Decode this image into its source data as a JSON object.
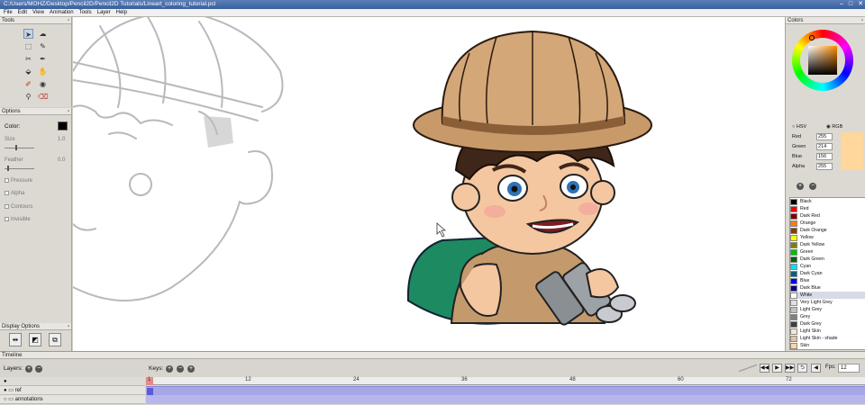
{
  "window": {
    "title": "C:/Users/MOHZ/Desktop/Pencil2D/Pencil2D Tutorials/Lineart_coloring_tutorial.pcl"
  },
  "menu": [
    "File",
    "Edit",
    "View",
    "Animation",
    "Tools",
    "Layer",
    "Help"
  ],
  "tools_panel": {
    "title": "Tools"
  },
  "options_panel": {
    "title": "Options",
    "color_label": "Color:",
    "size_label": "Size",
    "size_value": "1.0",
    "feather_label": "Feather",
    "feather_value": "0.0",
    "checks": [
      "Pressure",
      "Alpha",
      "Contours",
      "Invisible"
    ]
  },
  "display_panel": {
    "title": "Display Options"
  },
  "colors_panel": {
    "title": "Colors",
    "hsv_label": "HSV",
    "rgb_label": "RGB",
    "red_label": "Red",
    "red_value": "255",
    "green_label": "Green",
    "green_value": "214",
    "blue_label": "Blue",
    "blue_value": "156",
    "alpha_label": "Alpha",
    "alpha_value": "255",
    "current_color": "#ffd69c",
    "palette": [
      {
        "name": "Black",
        "color": "#000000"
      },
      {
        "name": "Red",
        "color": "#ff0000"
      },
      {
        "name": "Dark Red",
        "color": "#800000"
      },
      {
        "name": "Orange",
        "color": "#ff8000"
      },
      {
        "name": "Dark Orange",
        "color": "#804000"
      },
      {
        "name": "Yellow",
        "color": "#ffff00"
      },
      {
        "name": "Dark Yellow",
        "color": "#808000"
      },
      {
        "name": "Green",
        "color": "#00c000"
      },
      {
        "name": "Dark Green",
        "color": "#006000"
      },
      {
        "name": "Cyan",
        "color": "#00e0ff"
      },
      {
        "name": "Dark Cyan",
        "color": "#006080"
      },
      {
        "name": "Blue",
        "color": "#0000ff"
      },
      {
        "name": "Dark Blue",
        "color": "#000080"
      },
      {
        "name": "White",
        "color": "#ffffff"
      },
      {
        "name": "Very Light Grey",
        "color": "#e0e0e0"
      },
      {
        "name": "Light Grey",
        "color": "#c0c0c0"
      },
      {
        "name": "Grey",
        "color": "#808080"
      },
      {
        "name": "Dark Grey",
        "color": "#404040"
      },
      {
        "name": "Light Skin",
        "color": "#ffe4c8"
      },
      {
        "name": "Light Skin - shade",
        "color": "#e6c0a0"
      },
      {
        "name": "Skin",
        "color": "#ffd69c"
      }
    ],
    "selected_palette": "White"
  },
  "timeline": {
    "title": "Timeline",
    "layers_label": "Layers:",
    "keys_label": "Keys:",
    "fps_label": "Fps:",
    "fps_value": "12",
    "ruler_ticks": [
      "1",
      "12",
      "24",
      "36",
      "48",
      "60",
      "72"
    ],
    "layers": [
      {
        "name": "",
        "visible": true
      },
      {
        "name": "ref",
        "visible": true
      },
      {
        "name": "annotations",
        "visible": false
      },
      {
        "name": "",
        "visible": false
      }
    ]
  }
}
